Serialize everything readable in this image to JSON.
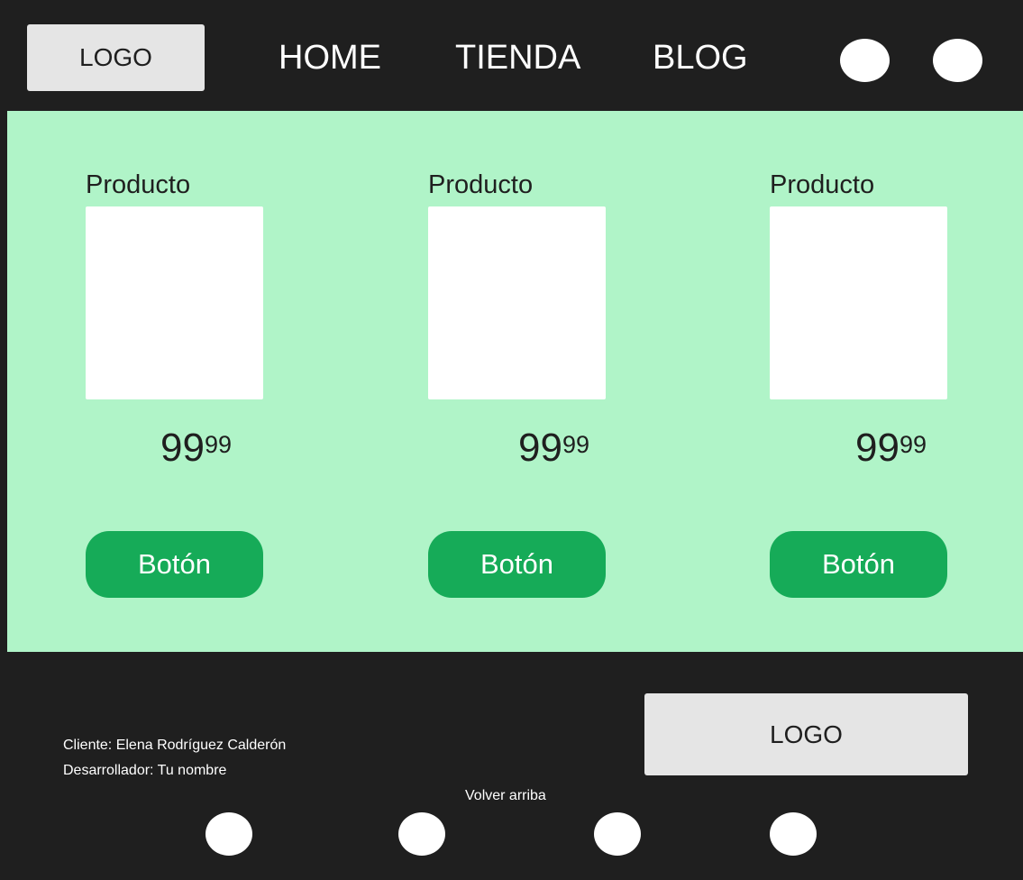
{
  "header": {
    "logo_text": "LOGO",
    "nav": [
      "HOME",
      "TIENDA",
      "BLOG"
    ]
  },
  "main": {
    "products": [
      {
        "title": "Producto",
        "price_main": "99",
        "price_fraction": "99",
        "button": "Botón"
      },
      {
        "title": "Producto",
        "price_main": "99",
        "price_fraction": "99",
        "button": "Botón"
      },
      {
        "title": "Producto",
        "price_main": "99",
        "price_fraction": "99",
        "button": "Botón"
      }
    ]
  },
  "footer": {
    "client": "Cliente: Elena Rodríguez Calderón",
    "developer": "Desarrollador: Tu nombre",
    "logo_text": "LOGO",
    "back_to_top": "Volver arriba"
  },
  "colors": {
    "dark": "#1f1f1f",
    "mint_background": "#b0f4c8",
    "green_button": "#16ab58",
    "logo_box": "#e5e5e5",
    "white": "#ffffff"
  }
}
